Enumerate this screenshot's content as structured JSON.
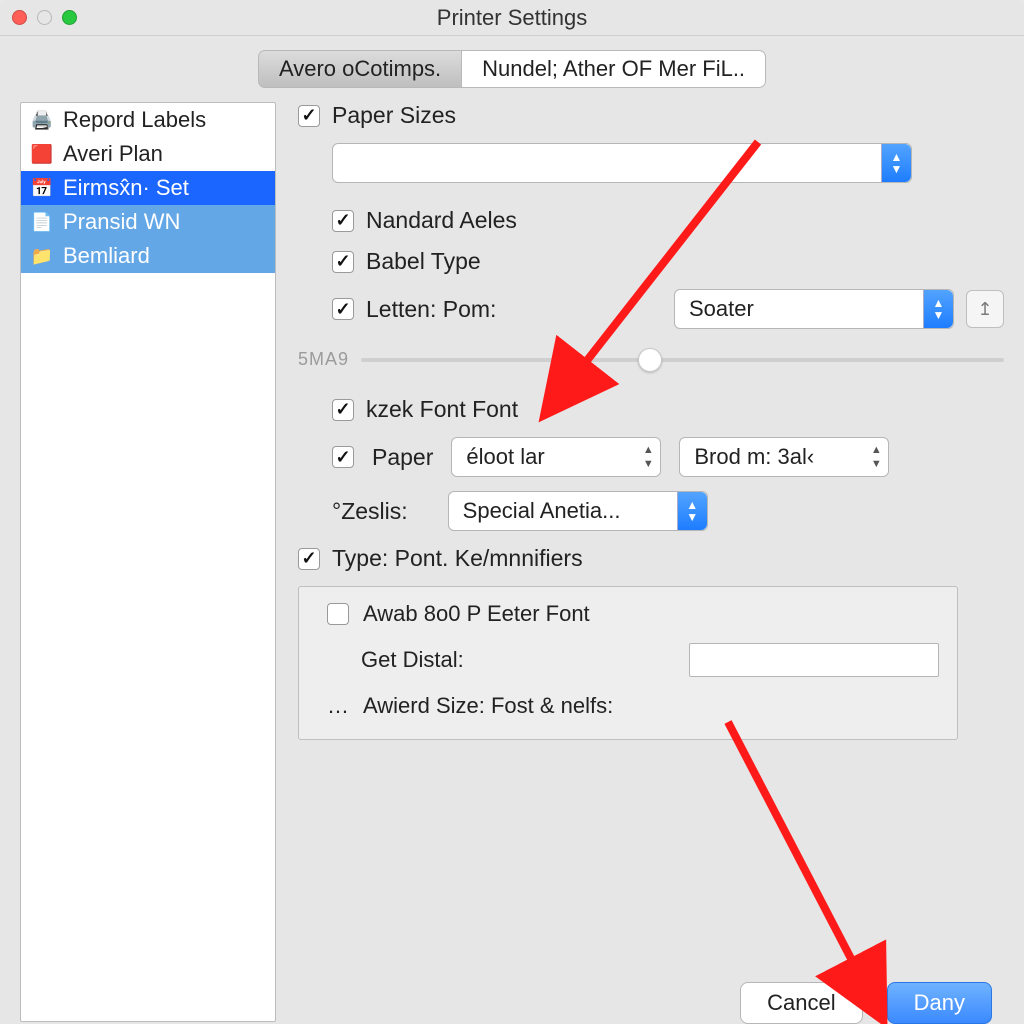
{
  "window": {
    "title": "Printer Settings"
  },
  "tabs": [
    {
      "label": "Avero oCotimps."
    },
    {
      "label": "Nundel;  Ather OF Mer FiL.."
    }
  ],
  "sidebar": {
    "items": [
      {
        "icon": "printer-icon",
        "label": "Repord Labels"
      },
      {
        "icon": "app-icon",
        "label": "Averi Plan"
      },
      {
        "icon": "calendar-icon",
        "label": "Eirmsx̂n· Set"
      },
      {
        "icon": "doc-icon",
        "label": "Pransid WN"
      },
      {
        "icon": "folder-icon",
        "label": "Bemliard"
      }
    ]
  },
  "main": {
    "paper_sizes": {
      "checked": true,
      "label": "Paper Sizes",
      "combo_value": ""
    },
    "nandard": {
      "checked": true,
      "label": "Nandard Aeles"
    },
    "babel": {
      "checked": true,
      "label": "Babel Type"
    },
    "letten": {
      "checked": true,
      "label": "Letten: Pom:",
      "combo_value": "Soater"
    },
    "slider": {
      "label": "5MA9",
      "value_pct": 45
    },
    "kzek": {
      "checked": true,
      "label": "kzek Font Font"
    },
    "paper2": {
      "checked": true,
      "label": "Paper",
      "combo1_value": "éloot lar",
      "combo2_value": "Brod m: 3al‹"
    },
    "zeslis": {
      "label": "°Zeslis:",
      "combo_value": "Special Anetia..."
    },
    "type_pont": {
      "checked": true,
      "label": "Type: Pont. Ke/mnnifiers"
    },
    "groupbox": {
      "awab": {
        "checked": false,
        "label": "Awab 8o0 P Eeter Font"
      },
      "get_distal": {
        "label": "Get Distal:",
        "value": ""
      },
      "awierd": {
        "prefix": "…",
        "label": "Awierd Size:  Fost & nelfs:"
      }
    }
  },
  "footer": {
    "cancel_label": "Cancel",
    "ok_label": "Dany"
  },
  "colors": {
    "accent": "#1a66ff",
    "soft_sel": "#64a7e6"
  }
}
